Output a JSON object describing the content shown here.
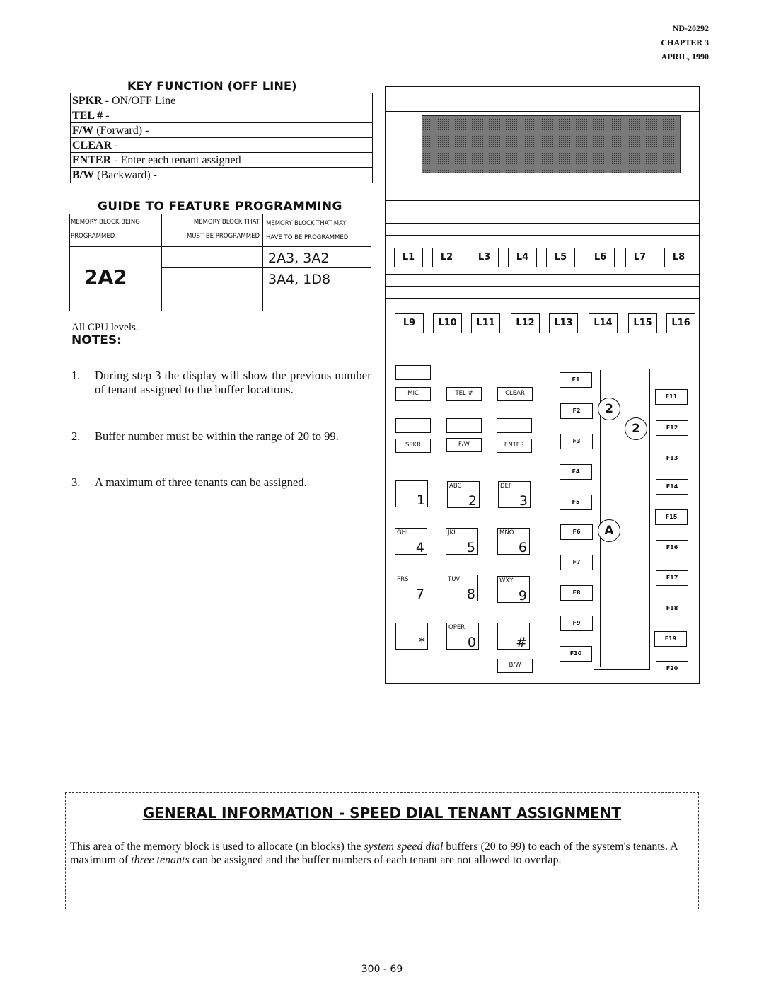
{
  "header": {
    "doc_number": "ND-20292",
    "chapter": "CHAPTER 3",
    "date": "APRIL, 1990"
  },
  "key_function": {
    "title": "KEY FUNCTION (OFF LINE)",
    "rows": [
      {
        "key": "SPKR",
        "desc": " - ON/OFF Line"
      },
      {
        "key": "TEL #",
        "desc": " -"
      },
      {
        "key": "F/W",
        "desc": " (Forward) -"
      },
      {
        "key": "CLEAR",
        "desc": " -"
      },
      {
        "key": "ENTER",
        "desc": " -  Enter each tenant assigned"
      },
      {
        "key": "B/W",
        "desc": " (Backward) -"
      }
    ]
  },
  "guide": {
    "title": "GUIDE TO FEATURE PROGRAMMING",
    "col1_header_line1": "MEMORY BLOCK BEING",
    "col1_header_line2": "PROGRAMMED",
    "col2_header_line1": "MEMORY BLOCK THAT",
    "col2_header_line2": "MUST BE PROGRAMMED",
    "col3_header_line1": "MEMORY BLOCK THAT MAY",
    "col3_header_line2": "HAVE TO BE PROGRAMMED",
    "block_being_programmed": "2A2",
    "must_be_programmed": [
      "",
      "",
      ""
    ],
    "may_have_to_be_programmed": [
      "2A3, 3A2",
      "3A4, 1D8",
      ""
    ]
  },
  "cpu_levels": "All CPU levels.",
  "notes": {
    "title": "NOTES:",
    "items": [
      {
        "num": "1.",
        "text": "During step 3 the display will show the previous number of tenant assigned to the buffer locations."
      },
      {
        "num": "2.",
        "text": "Buffer number must be within the range of 20 to 99."
      },
      {
        "num": "3.",
        "text": "A maximum of three tenants can be assigned."
      }
    ]
  },
  "phone": {
    "line_keys_row1": [
      "L1",
      "L2",
      "L3",
      "L4",
      "L5",
      "L6",
      "L7",
      "L8"
    ],
    "line_keys_row2": [
      "L9",
      "L10",
      "L11",
      "L12",
      "L13",
      "L14",
      "L15",
      "L16"
    ],
    "soft_keys": {
      "mic": "MIC",
      "tel": "TEL #",
      "clear": "CLEAR",
      "spkr": "SPKR",
      "fw": "F/W",
      "enter": "ENTER",
      "bw": "B/W"
    },
    "dial_keys": [
      {
        "letters": "",
        "digit": "1"
      },
      {
        "letters": "ABC",
        "digit": "2"
      },
      {
        "letters": "DEF",
        "digit": "3"
      },
      {
        "letters": "GHI",
        "digit": "4"
      },
      {
        "letters": "JKL",
        "digit": "5"
      },
      {
        "letters": "MNO",
        "digit": "6"
      },
      {
        "letters": "PRS",
        "digit": "7"
      },
      {
        "letters": "TUV",
        "digit": "8"
      },
      {
        "letters": "WXY",
        "digit": "9"
      },
      {
        "letters": "",
        "digit": "*"
      },
      {
        "letters": "OPER",
        "digit": "0"
      },
      {
        "letters": "",
        "digit": "#"
      }
    ],
    "function_keys_left": [
      "F1",
      "F2",
      "F3",
      "F4",
      "F5",
      "F6",
      "F7",
      "F8",
      "F9",
      "F10"
    ],
    "function_keys_right": [
      "F11",
      "F12",
      "F13",
      "F14",
      "F15",
      "F16",
      "F17",
      "F18",
      "F19",
      "F20"
    ],
    "callouts": {
      "step_a": "2",
      "step_b": "2",
      "step_c": "A"
    }
  },
  "general_info": {
    "title": "GENERAL INFORMATION  -  SPEED DIAL TENANT ASSIGNMENT",
    "body_part1": "This area of the memory block is used to allocate (in blocks) the ",
    "body_italic1": "system speed dial",
    "body_part2": " buffers (20 to 99) to each of the system's tenants.  A maximum of ",
    "body_italic2": "three tenants",
    "body_part3": " can be assigned and the buffer numbers of each tenant are not allowed to overlap."
  },
  "footer": {
    "page_number": "300 - 69"
  }
}
